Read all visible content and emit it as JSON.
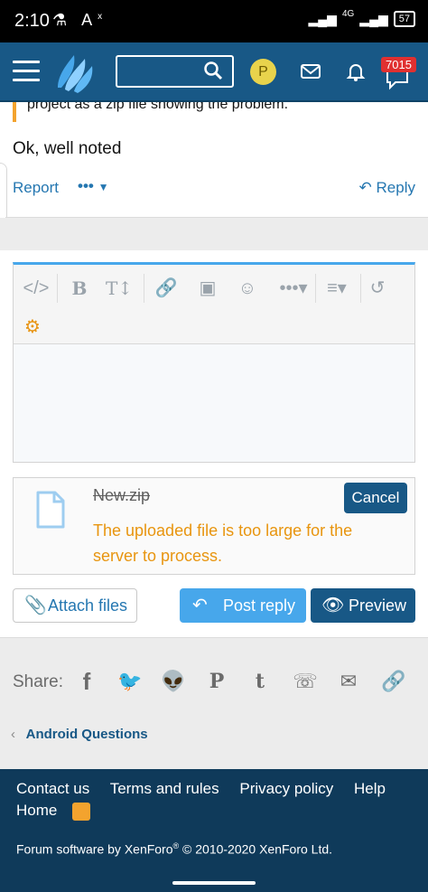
{
  "status_bar": {
    "time": "2:10",
    "network": "4G",
    "battery": "57"
  },
  "navbar": {
    "avatar_letter": "P",
    "alerts_count": "7015",
    "search_placeholder": ""
  },
  "post": {
    "quote_tail": "project as a zip file showing the problem.",
    "text": "Ok, well noted",
    "report_label": "Report",
    "more_label": "•••",
    "reply_label": "Reply"
  },
  "editor": {
    "toolbar": [
      "code-icon",
      "bold-icon",
      "text-size-icon",
      "link-icon",
      "image-icon",
      "smilie-icon",
      "more-icon",
      "align-icon",
      "undo-icon",
      "settings-gear-icon"
    ]
  },
  "attachment": {
    "filename": "New.zip",
    "error": "The uploaded file is too large for the server to process.",
    "cancel_label": "Cancel"
  },
  "actions": {
    "attach_label": "Attach files",
    "post_reply_label": "Post reply",
    "preview_label": "Preview"
  },
  "share": {
    "label": "Share:",
    "icons": [
      "facebook-icon",
      "twitter-icon",
      "reddit-icon",
      "pinterest-icon",
      "tumblr-icon",
      "whatsapp-icon",
      "email-icon",
      "link-icon"
    ]
  },
  "breadcrumb": {
    "label": "Android Questions"
  },
  "footer": {
    "links": [
      "Contact us",
      "Terms and rules",
      "Privacy policy",
      "Help",
      "Home"
    ],
    "copyright_prefix": "Forum software by XenForo",
    "registered": "®",
    "copyright_suffix": " © 2010-2020 XenForo Ltd."
  },
  "colors": {
    "brand": "#185886",
    "accent": "#47a7eb",
    "warning": "#e8950f",
    "alert_badge": "#e03030"
  }
}
